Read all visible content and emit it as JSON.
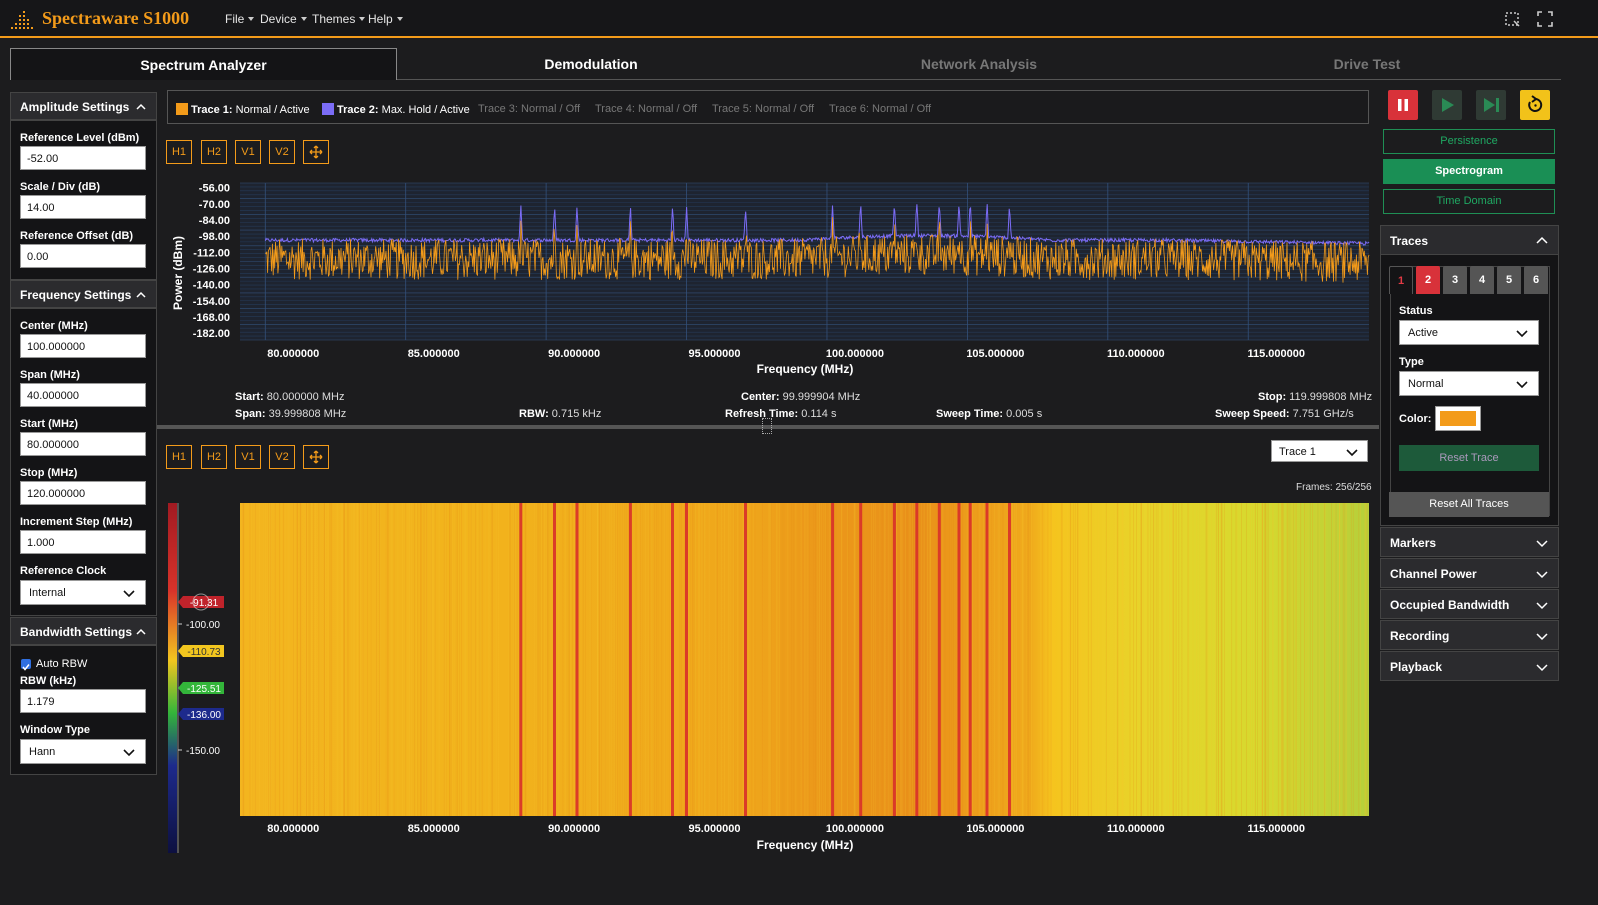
{
  "app": {
    "title": "Spectraware S1000",
    "accent": "#f39b1a"
  },
  "menu": [
    "File",
    "Device",
    "Themes",
    "Help"
  ],
  "tabs": [
    {
      "label": "Spectrum Analyzer",
      "state": "active"
    },
    {
      "label": "Demodulation",
      "state": "normal"
    },
    {
      "label": "Network Analysis",
      "state": "disabled"
    },
    {
      "label": "Drive Test",
      "state": "disabled"
    }
  ],
  "amplitude": {
    "header": "Amplitude Settings",
    "ref_level_label": "Reference Level (dBm)",
    "ref_level": "-52.00",
    "scale_label": "Scale / Div (dB)",
    "scale": "14.00",
    "offset_label": "Reference Offset (dB)",
    "offset": "0.00"
  },
  "frequency": {
    "header": "Frequency Settings",
    "center_label": "Center (MHz)",
    "center": "100.000000",
    "span_label": "Span (MHz)",
    "span": "40.000000",
    "start_label": "Start (MHz)",
    "start": "80.000000",
    "stop_label": "Stop (MHz)",
    "stop": "120.000000",
    "step_label": "Increment Step (MHz)",
    "step": "1.000",
    "clock_label": "Reference Clock",
    "clock": "Internal"
  },
  "bandwidth": {
    "header": "Bandwidth Settings",
    "auto_rbw_label": "Auto RBW",
    "auto_rbw": true,
    "rbw_label": "RBW (kHz)",
    "rbw": "1.179",
    "window_label": "Window Type",
    "window": "Hann"
  },
  "traces_bar": [
    {
      "name": "Trace 1:",
      "mode": "Normal / Active",
      "color": "#f39b1a",
      "active": true
    },
    {
      "name": "Trace 2:",
      "mode": "Max. Hold / Active",
      "color": "#7b6cf6",
      "active": true
    },
    {
      "name": "Trace 3:",
      "mode": "Normal / Off",
      "active": false
    },
    {
      "name": "Trace 4:",
      "mode": "Normal / Off",
      "active": false
    },
    {
      "name": "Trace 5:",
      "mode": "Normal / Off",
      "active": false
    },
    {
      "name": "Trace 6:",
      "mode": "Normal / Off",
      "active": false
    }
  ],
  "marker_buttons": [
    "H1",
    "H2",
    "V1",
    "V2"
  ],
  "chart_data": [
    {
      "type": "line",
      "ylabel": "Power (dBm)",
      "xlabel": "Frequency (MHz)",
      "yticks": [
        "-56.00",
        "-70.00",
        "-84.00",
        "-98.00",
        "-112.00",
        "-126.00",
        "-140.00",
        "-154.00",
        "-168.00",
        "-182.00"
      ],
      "xticks": [
        "80.000000",
        "85.000000",
        "90.000000",
        "95.000000",
        "100.000000",
        "105.000000",
        "110.000000",
        "115.000000"
      ],
      "xlim": [
        79.1,
        119.3
      ],
      "ylim": [
        -188,
        -52
      ],
      "series": [
        {
          "name": "Trace 1",
          "color": "#f39b1a",
          "noise_floor": -118,
          "noise_range": [
            -150,
            -100
          ]
        },
        {
          "name": "Trace 2",
          "color": "#7b6cf6",
          "max_hold_floor": -103
        }
      ],
      "peaks_mhz": [
        89.1,
        90.3,
        91.1,
        93.0,
        94.5,
        95.0,
        97.1,
        100.2,
        101.2,
        102.4,
        103.2,
        104.0,
        104.7,
        105.1,
        105.7,
        106.5
      ]
    },
    {
      "type": "heatmap",
      "xlabel": "Frequency (MHz)",
      "xticks": [
        "80.000000",
        "85.000000",
        "90.000000",
        "95.000000",
        "100.000000",
        "105.000000",
        "110.000000",
        "115.000000"
      ],
      "xlim": [
        79.1,
        119.3
      ],
      "colorbar_ticks": [
        "-100.00",
        "-150.00"
      ],
      "colorbar_markers": [
        {
          "label": "-91.31",
          "color": "#c0232b"
        },
        {
          "label": "-110.73",
          "color": "#f2c61f"
        },
        {
          "label": "-125.51",
          "color": "#33b53a"
        },
        {
          "label": "-136.00",
          "color": "#1d2a8c"
        }
      ],
      "frames": "Frames: 256/256",
      "trace_select": "Trace 1"
    }
  ],
  "info": {
    "start_label": "Start:",
    "start": "80.000000 MHz",
    "span_label": "Span:",
    "span": "39.999808 MHz",
    "rbw_label": "RBW:",
    "rbw": "0.715 kHz",
    "center_label": "Center:",
    "center": "99.999904 MHz",
    "refresh_label": "Refresh Time:",
    "refresh": "0.114 s",
    "sweep_label": "Sweep Time:",
    "sweep": "0.005 s",
    "stop_label": "Stop:",
    "stop": "119.999808 MHz",
    "speed_label": "Sweep Speed:",
    "speed": "7.751 GHz/s"
  },
  "right": {
    "modes": [
      {
        "label": "Persistence",
        "active": false
      },
      {
        "label": "Spectrogram",
        "active": true
      },
      {
        "label": "Time Domain",
        "active": false
      }
    ],
    "traces_header": "Traces",
    "trace_tabs": [
      "1",
      "2",
      "3",
      "4",
      "5",
      "6"
    ],
    "status_label": "Status",
    "status": "Active",
    "type_label": "Type",
    "type": "Normal",
    "color_label": "Color:",
    "color": "#f39b1a",
    "reset_trace": "Reset Trace",
    "reset_all": "Reset All Traces",
    "sections": [
      "Markers",
      "Channel Power",
      "Occupied Bandwidth",
      "Recording",
      "Playback"
    ]
  }
}
